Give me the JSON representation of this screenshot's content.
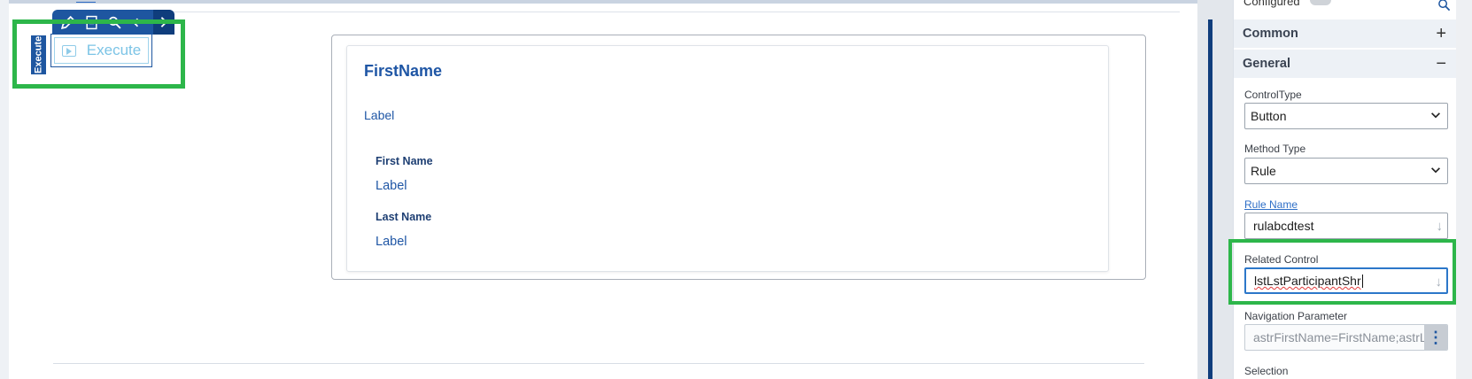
{
  "control": {
    "side_tag": "Execute",
    "button_label": "Execute",
    "toolbar_icons": [
      "pencil-icon",
      "document-icon",
      "search-icon",
      "back-arrow-icon",
      "forward-arrow-icon",
      "next-chevron-icon"
    ]
  },
  "panel": {
    "title": "FirstName",
    "label": "Label",
    "fields": [
      {
        "title": "First Name",
        "value": "Label"
      },
      {
        "title": "Last Name",
        "value": "Label"
      }
    ]
  },
  "properties": {
    "top_cut_label": "Configured",
    "sections": [
      {
        "title": "Common",
        "sign": "+"
      },
      {
        "title": "General",
        "sign": "−"
      }
    ],
    "control_type": {
      "label": "ControlType",
      "value": "Button"
    },
    "method_type": {
      "label": "Method Type",
      "value": "Rule"
    },
    "rule_name": {
      "label": "Rule Name",
      "value": "rulabcdtest"
    },
    "related_control": {
      "label": "Related Control",
      "value": "lstLstParticipantShr"
    },
    "navigation_parameter": {
      "label": "Navigation Parameter",
      "value": "astrFirstName=FirstName;astrLa"
    },
    "selection": {
      "label": "Selection"
    }
  },
  "colors": {
    "accent": "#1e56a0",
    "highlight": "#2db64a",
    "link": "#2f6fc7"
  }
}
